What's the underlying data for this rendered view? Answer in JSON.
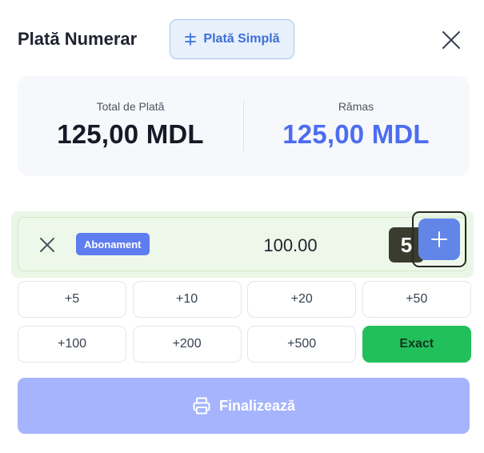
{
  "header": {
    "title": "Plată Numerar",
    "mode_button_label": "Plată Simplă",
    "mode_button_icon": "split-icon",
    "close_icon": "close-icon"
  },
  "summary": {
    "total_label": "Total de Plată",
    "total_value": "125,00 MDL",
    "remaining_label": "Rămas",
    "remaining_value": "125,00 MDL",
    "remaining_color": "#4d6df0"
  },
  "entry": {
    "badge_label": "Abonament",
    "amount": "100.00",
    "step_tag": "5",
    "remove_icon": "close-icon",
    "add_icon": "plus-icon"
  },
  "quick_amounts": [
    "+5",
    "+10",
    "+20",
    "+50",
    "+100",
    "+200",
    "+500"
  ],
  "exact_label": "Exact",
  "exact_color": "#22c05b",
  "finish": {
    "label": "Finalizează",
    "icon": "printer-icon",
    "color": "#a5b4fc"
  }
}
